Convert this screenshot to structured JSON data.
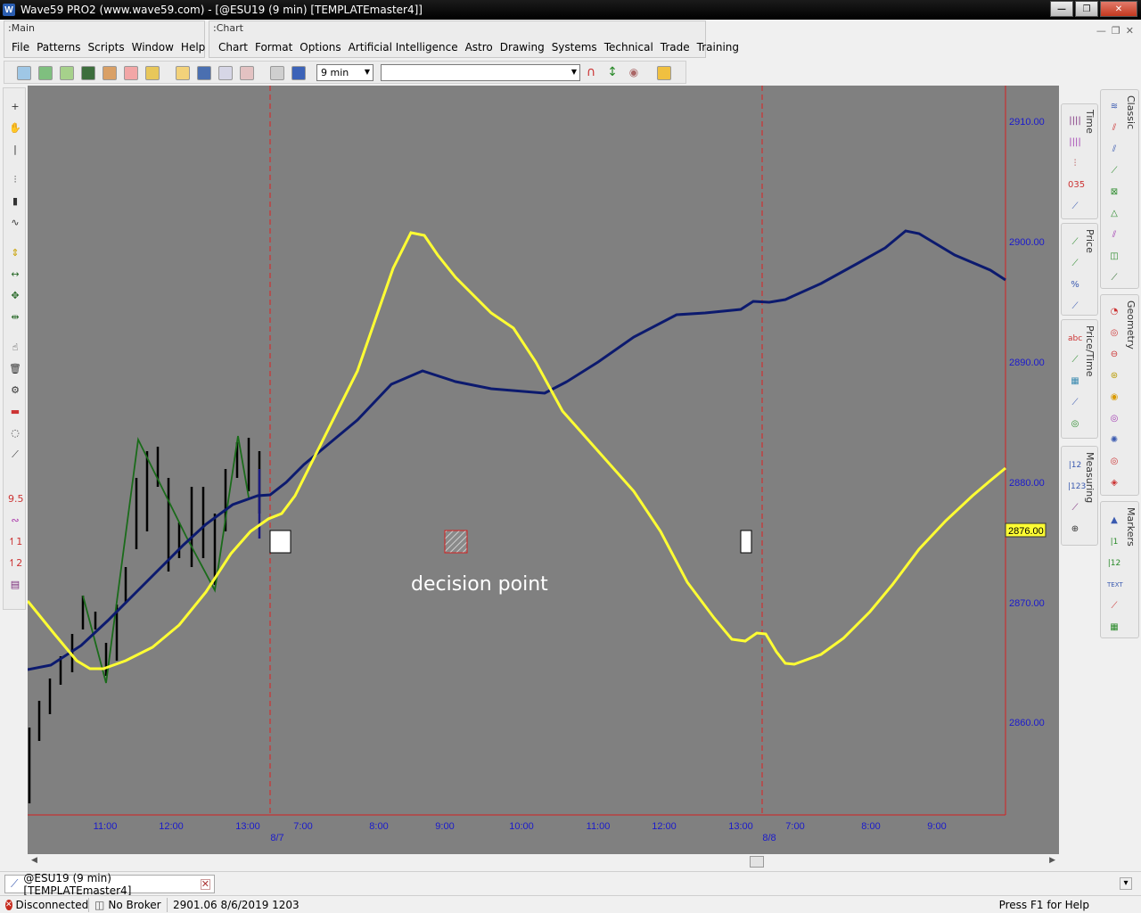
{
  "window": {
    "title": "Wave59 PRO2 (www.wave59.com) - [@ESU19 (9 min) [TEMPLATEmaster4]]",
    "app_icon": "W"
  },
  "menus": {
    "main": {
      "title": ":Main",
      "items": [
        "File",
        "Patterns",
        "Scripts",
        "Window",
        "Help"
      ]
    },
    "chart": {
      "title": ":Chart",
      "items": [
        "Chart",
        "Format",
        "Options",
        "Artificial Intelligence",
        "Astro",
        "Drawing",
        "Systems",
        "Technical",
        "Trade",
        "Training"
      ]
    }
  },
  "toolbar": {
    "interval_value": "9 min",
    "symbol_value": ""
  },
  "chart": {
    "price_labels": [
      "2910.00",
      "2900.00",
      "2890.00",
      "2880.00",
      "2870.00",
      "2860.00"
    ],
    "current_price": "2876.00",
    "time_labels": [
      "11:00",
      "12:00",
      "13:00",
      "7:00",
      "8:00",
      "9:00",
      "10:00",
      "11:00",
      "12:00",
      "13:00",
      "7:00",
      "8:00",
      "9:00"
    ],
    "date_labels": [
      "8/7",
      "8/8"
    ],
    "annotation": "decision point",
    "colors": {
      "background": "#808080",
      "yellow_line": "#ffff33",
      "blue_line": "#0c1a6e",
      "zigzag": "#1a6b1a",
      "axis_text": "#1a1acc",
      "separator": "#e02020"
    }
  },
  "right_panels": {
    "time": "Time",
    "price": "Price",
    "price_time": "Price/Time",
    "measuring": "Measuring",
    "classic": "Classic",
    "geometry": "Geometry",
    "markers": "Markers"
  },
  "tab": {
    "label": "@ESU19 (9 min) [TEMPLATEmaster4]"
  },
  "status": {
    "connection": "Disconnected",
    "broker": "No Broker",
    "info": "2901.06  8/6/2019  1203",
    "help": "Press F1 for Help"
  }
}
